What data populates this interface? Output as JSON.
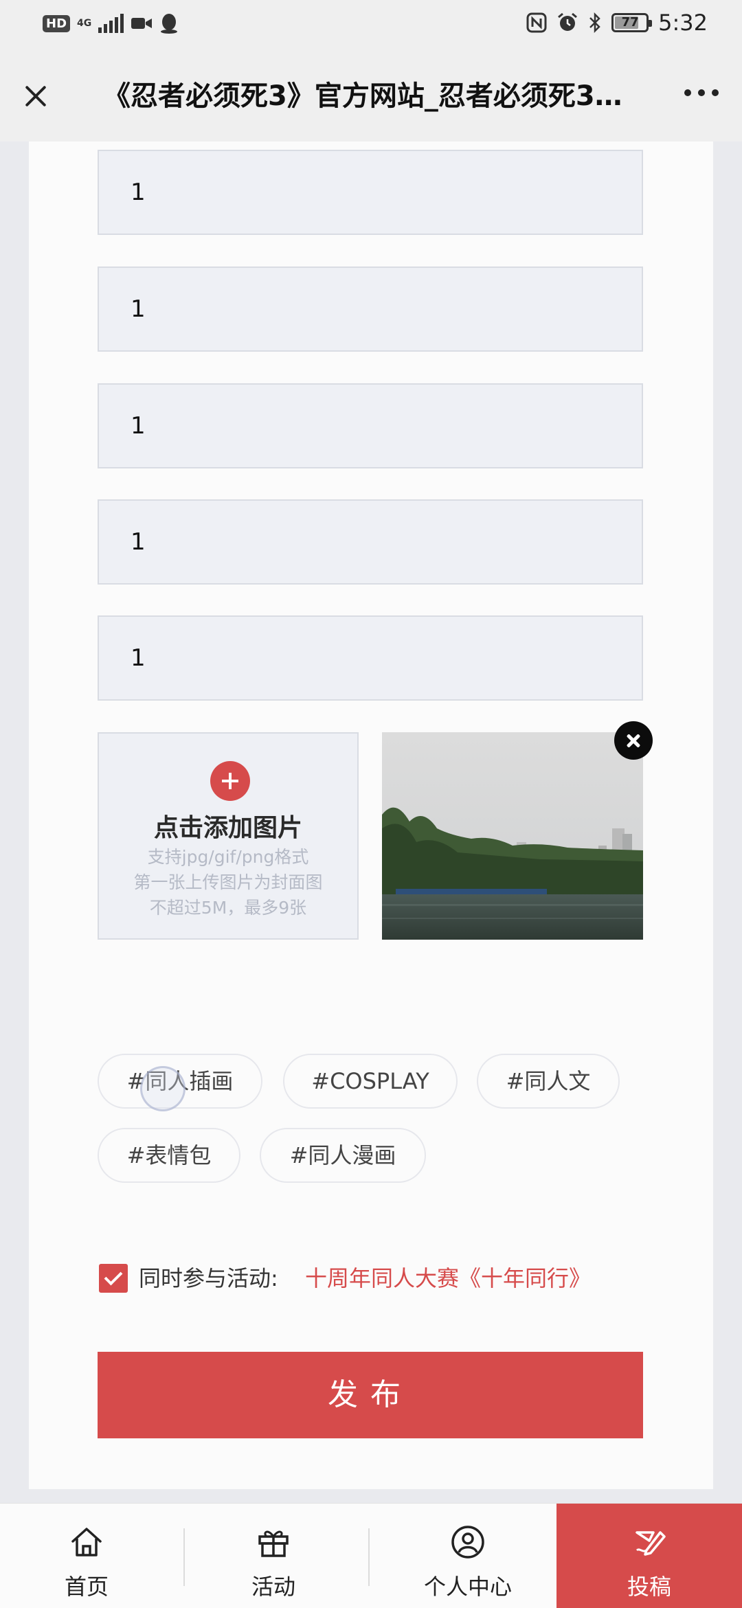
{
  "status_bar": {
    "left_badge": "HD",
    "network": "4G",
    "time": "5:32",
    "battery": "77",
    "battery_fraction": 0.77
  },
  "header": {
    "title": "《忍者必须死3》官方网站_忍者必须死3官方网站"
  },
  "form": {
    "fields": [
      {
        "value": "1"
      },
      {
        "value": "1"
      },
      {
        "value": "1"
      },
      {
        "value": "1"
      },
      {
        "value": "1"
      }
    ],
    "upload": {
      "title": "点击添加图片",
      "hints": [
        "支持jpg/gif/png格式",
        "第一张上传图片为封面图",
        "不超过5M，最多9张"
      ]
    },
    "tags": [
      "#同人插画",
      "#COSPLAY",
      "#同人文",
      "#表情包",
      "#同人漫画"
    ],
    "activity": {
      "checked": true,
      "label": "同时参与活动:",
      "link": "十周年同人大赛《十年同行》"
    },
    "publish_label": "发布"
  },
  "bottom_nav": {
    "items": [
      {
        "label": "首页",
        "icon": "home-icon"
      },
      {
        "label": "活动",
        "icon": "gift-icon"
      },
      {
        "label": "个人中心",
        "icon": "user-circle-icon"
      },
      {
        "label": "投稿",
        "icon": "submit-pen-icon",
        "active": true
      }
    ]
  },
  "colors": {
    "accent": "#d64b4b",
    "field_bg": "#eef0f5",
    "page_bg": "#e9eaee"
  }
}
